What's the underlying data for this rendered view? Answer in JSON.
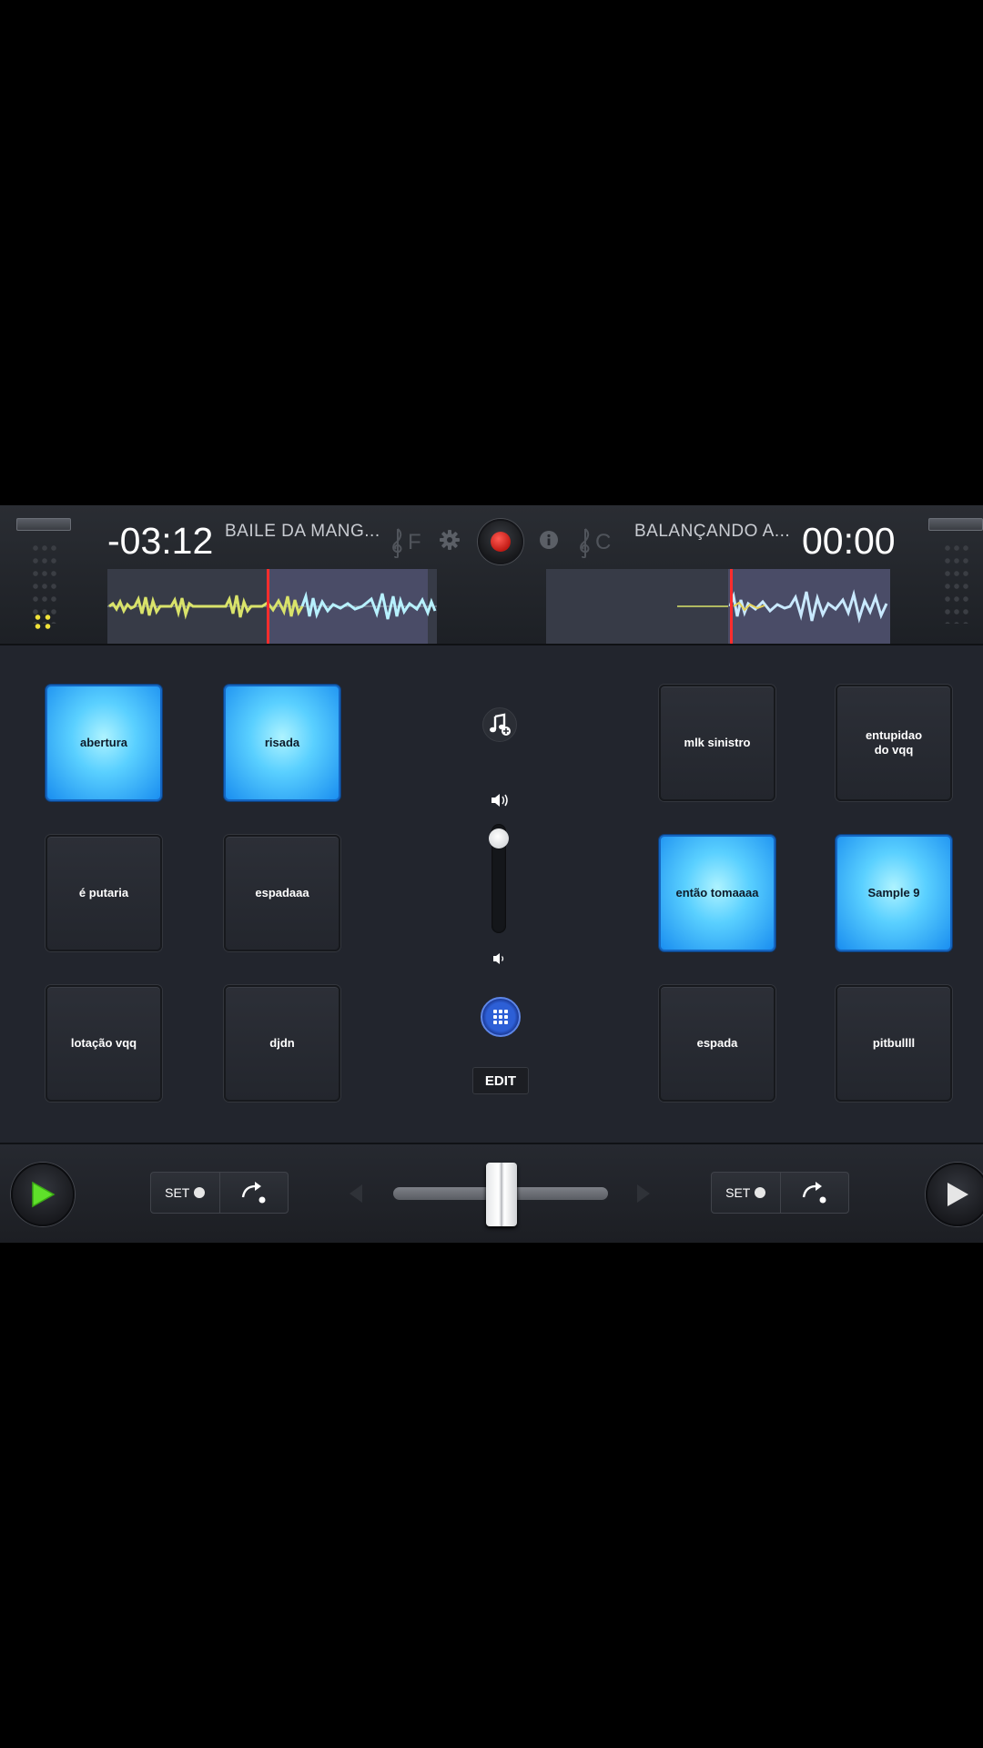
{
  "deck_left": {
    "time": "-03:12",
    "title": "BAILE DA MANG...",
    "key": "F",
    "set_label": "SET"
  },
  "deck_right": {
    "time": "00:00",
    "title": "BALANÇANDO A...",
    "key": "C",
    "set_label": "SET"
  },
  "pads_left": [
    {
      "label": "abertura",
      "active": true
    },
    {
      "label": "risada",
      "active": true
    },
    {
      "label": "é putaria",
      "active": false
    },
    {
      "label": "espadaaa",
      "active": false
    },
    {
      "label": "lotação vqq",
      "active": false
    },
    {
      "label": "djdn",
      "active": false
    }
  ],
  "pads_right": [
    {
      "label": "mlk sinistro",
      "active": false
    },
    {
      "label": "entupidao do vqq",
      "active": false
    },
    {
      "label": "então tomaaaa",
      "active": true
    },
    {
      "label": "Sample 9",
      "active": true
    },
    {
      "label": "espada",
      "active": false
    },
    {
      "label": "pitbullll",
      "active": false
    }
  ],
  "center": {
    "edit_label": "EDIT",
    "sampler_volume": 0.9
  },
  "colors": {
    "pad_active": "#5ad0ff",
    "playhead": "#ff2d2d",
    "record": "#d9251d",
    "play_active": "#4cd51f"
  }
}
